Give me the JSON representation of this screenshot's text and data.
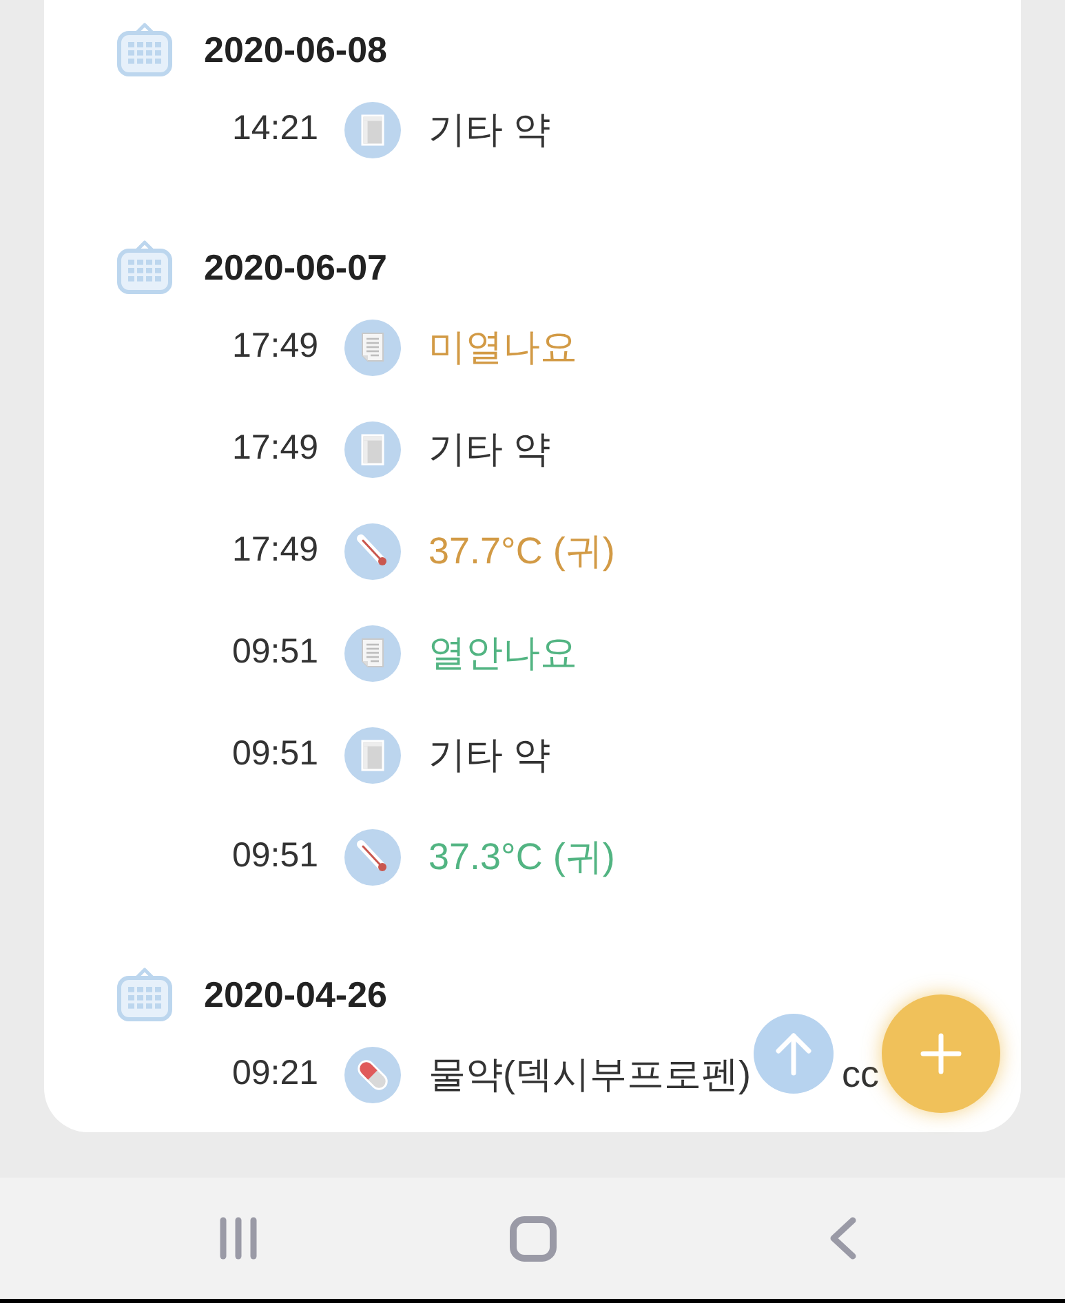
{
  "groups": [
    {
      "date": "2020-06-08",
      "entries": [
        {
          "time": "14:21",
          "kind": "medicine",
          "label": "기타 약",
          "color": "#333333"
        }
      ]
    },
    {
      "date": "2020-06-07",
      "entries": [
        {
          "time": "17:49",
          "kind": "note",
          "label": "미열나요",
          "color": "#d29a45"
        },
        {
          "time": "17:49",
          "kind": "medicine",
          "label": "기타 약",
          "color": "#333333"
        },
        {
          "time": "17:49",
          "kind": "temperature",
          "label": "37.7°C (귀)",
          "color": "#d29a45"
        },
        {
          "time": "09:51",
          "kind": "note",
          "label": "열안나요",
          "color": "#52b482"
        },
        {
          "time": "09:51",
          "kind": "medicine",
          "label": "기타 약",
          "color": "#333333"
        },
        {
          "time": "09:51",
          "kind": "temperature",
          "label": "37.3°C (귀)",
          "color": "#52b482"
        }
      ]
    },
    {
      "date": "2020-04-26",
      "entries": [
        {
          "time": "09:21",
          "kind": "syrup",
          "label": "물약(덱시부프로펜)",
          "label_tail": "cc",
          "color": "#333333"
        }
      ]
    }
  ]
}
